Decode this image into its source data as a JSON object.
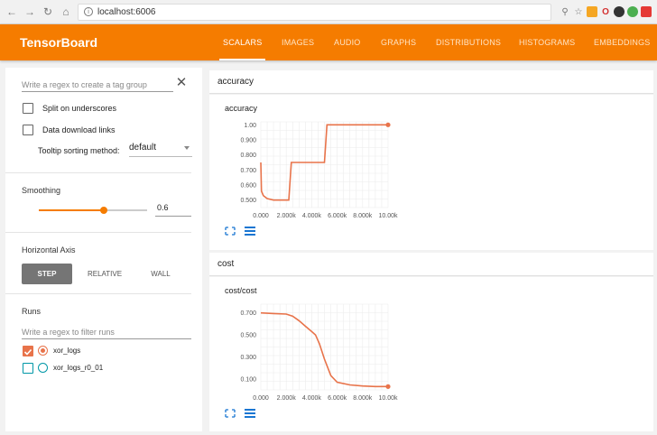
{
  "browser": {
    "url": "localhost:6006",
    "nav_icons": [
      "back-icon",
      "forward-icon",
      "reload-icon",
      "home-icon"
    ]
  },
  "header": {
    "brand": "TensorBoard",
    "tabs": [
      {
        "label": "SCALARS",
        "active": true
      },
      {
        "label": "IMAGES",
        "active": false
      },
      {
        "label": "AUDIO",
        "active": false
      },
      {
        "label": "GRAPHS",
        "active": false
      },
      {
        "label": "DISTRIBUTIONS",
        "active": false
      },
      {
        "label": "HISTOGRAMS",
        "active": false
      },
      {
        "label": "EMBEDDINGS",
        "active": false
      }
    ],
    "accent": "#f57c00"
  },
  "sidebar": {
    "tag_regex_placeholder": "Write a regex to create a tag group",
    "split_on_underscores": "Split on underscores",
    "data_download_links": "Data download links",
    "tooltip_label": "Tooltip sorting method:",
    "tooltip_value": "default",
    "smoothing_title": "Smoothing",
    "smoothing_value": "0.6",
    "smoothing_fraction": 0.6,
    "horizontal_axis_title": "Horizontal Axis",
    "axis_options": [
      "STEP",
      "RELATIVE",
      "WALL"
    ],
    "axis_selected": "STEP",
    "runs_title": "Runs",
    "runs_filter_placeholder": "Write a regex to filter runs",
    "runs": [
      {
        "name": "xor_logs",
        "checked": true,
        "color": "#e8734a"
      },
      {
        "name": "xor_logs_r0_01",
        "checked": false,
        "color": "#0097a7"
      }
    ]
  },
  "sections": [
    {
      "name": "accuracy",
      "card_title": "accuracy"
    },
    {
      "name": "cost",
      "card_title": "cost/cost"
    }
  ],
  "chart_data": [
    {
      "type": "line",
      "title": "accuracy",
      "xlabel": "",
      "ylabel": "",
      "x_ticks": [
        "0.000",
        "2.000k",
        "4.000k",
        "6.000k",
        "8.000k",
        "10.00k"
      ],
      "y_ticks": [
        "0.500",
        "0.600",
        "0.700",
        "0.800",
        "0.900",
        "1.00"
      ],
      "xlim": [
        0,
        10000
      ],
      "ylim": [
        0.45,
        1.02
      ],
      "grid": true,
      "series": [
        {
          "color": "#e8734a",
          "x": [
            0,
            50,
            200,
            500,
            1000,
            1800,
            2200,
            2400,
            4800,
            5000,
            5200,
            10000
          ],
          "y": [
            0.75,
            0.56,
            0.53,
            0.51,
            0.5,
            0.5,
            0.5,
            0.75,
            0.75,
            0.75,
            1.0,
            1.0
          ]
        }
      ]
    },
    {
      "type": "line",
      "title": "cost/cost",
      "xlabel": "",
      "ylabel": "",
      "x_ticks": [
        "0.000",
        "2.000k",
        "4.000k",
        "6.000k",
        "8.000k",
        "10.00k"
      ],
      "y_ticks": [
        "0.100",
        "0.300",
        "0.500",
        "0.700"
      ],
      "xlim": [
        0,
        10000
      ],
      "ylim": [
        0.0,
        0.78
      ],
      "grid": true,
      "series": [
        {
          "color": "#e8734a",
          "x": [
            0,
            1000,
            2000,
            2500,
            3000,
            3500,
            4000,
            4300,
            4600,
            5000,
            5500,
            6000,
            7000,
            8000,
            9000,
            10000
          ],
          "y": [
            0.7,
            0.695,
            0.69,
            0.67,
            0.63,
            0.58,
            0.53,
            0.5,
            0.42,
            0.28,
            0.13,
            0.07,
            0.045,
            0.035,
            0.03,
            0.03
          ]
        }
      ]
    }
  ]
}
